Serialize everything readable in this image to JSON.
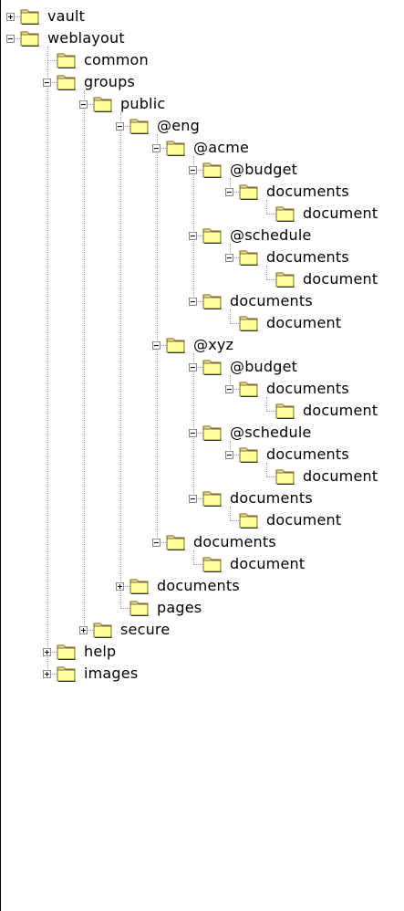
{
  "tree": {
    "rows": [
      {
        "label": "vault",
        "depth": 0,
        "toggle": "plus"
      },
      {
        "label": "weblayout",
        "depth": 0,
        "toggle": "minus"
      },
      {
        "label": "common",
        "depth": 1,
        "toggle": "none"
      },
      {
        "label": "groups",
        "depth": 1,
        "toggle": "minus"
      },
      {
        "label": "public",
        "depth": 2,
        "toggle": "minus"
      },
      {
        "label": "@eng",
        "depth": 3,
        "toggle": "minus"
      },
      {
        "label": "@acme",
        "depth": 4,
        "toggle": "minus"
      },
      {
        "label": "@budget",
        "depth": 5,
        "toggle": "minus"
      },
      {
        "label": "documents",
        "depth": 6,
        "toggle": "minus"
      },
      {
        "label": "document",
        "depth": 7,
        "toggle": "none"
      },
      {
        "label": "@schedule",
        "depth": 5,
        "toggle": "minus"
      },
      {
        "label": "documents",
        "depth": 6,
        "toggle": "minus"
      },
      {
        "label": "document",
        "depth": 7,
        "toggle": "none"
      },
      {
        "label": "documents",
        "depth": 5,
        "toggle": "minus"
      },
      {
        "label": "document",
        "depth": 6,
        "toggle": "none"
      },
      {
        "label": "@xyz",
        "depth": 4,
        "toggle": "minus"
      },
      {
        "label": "@budget",
        "depth": 5,
        "toggle": "minus"
      },
      {
        "label": "documents",
        "depth": 6,
        "toggle": "minus"
      },
      {
        "label": "document",
        "depth": 7,
        "toggle": "none"
      },
      {
        "label": "@schedule",
        "depth": 5,
        "toggle": "minus"
      },
      {
        "label": "documents",
        "depth": 6,
        "toggle": "minus"
      },
      {
        "label": "document",
        "depth": 7,
        "toggle": "none"
      },
      {
        "label": "documents",
        "depth": 5,
        "toggle": "minus"
      },
      {
        "label": "document",
        "depth": 6,
        "toggle": "none"
      },
      {
        "label": "documents",
        "depth": 4,
        "toggle": "minus"
      },
      {
        "label": "document",
        "depth": 5,
        "toggle": "none"
      },
      {
        "label": "documents",
        "depth": 3,
        "toggle": "plus"
      },
      {
        "label": "pages",
        "depth": 3,
        "toggle": "none"
      },
      {
        "label": "secure",
        "depth": 2,
        "toggle": "plus"
      },
      {
        "label": "help",
        "depth": 1,
        "toggle": "plus"
      },
      {
        "label": "images",
        "depth": 1,
        "toggle": "plus"
      }
    ]
  },
  "colors": {
    "folder_fill": "#fffd9c",
    "folder_tab": "#f4e07a",
    "folder_outline": "#7a6a1a",
    "connector": "#9a9a9a",
    "frame": "#000000",
    "background": "#ffffff"
  },
  "icons": {
    "folder": "folder-icon",
    "expand": "plus-box-icon",
    "collapse": "minus-box-icon"
  }
}
